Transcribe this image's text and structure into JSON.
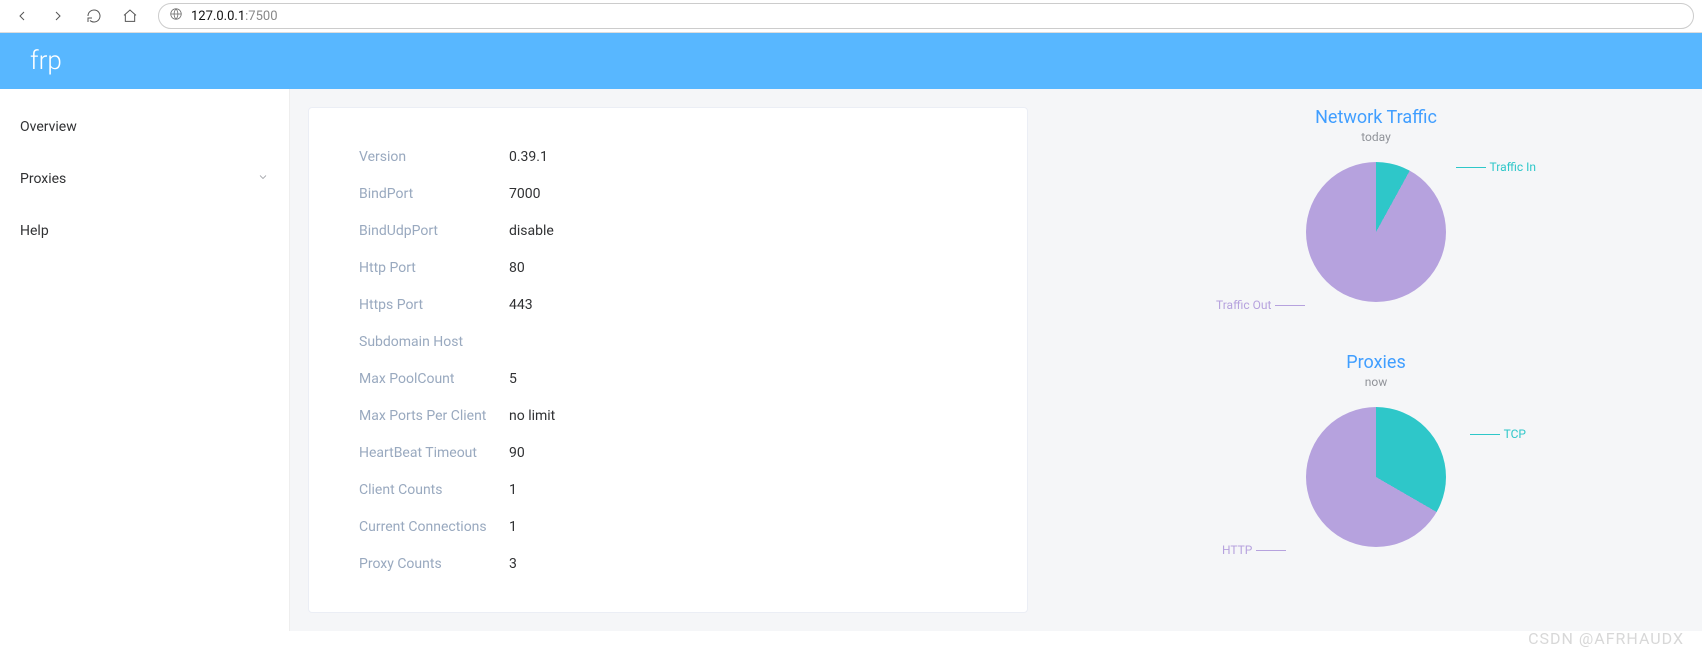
{
  "browser": {
    "url_host": "127.0.0.1",
    "url_port": ":7500"
  },
  "app": {
    "title": "frp"
  },
  "sidebar": {
    "items": [
      {
        "label": "Overview"
      },
      {
        "label": "Proxies"
      },
      {
        "label": "Help"
      }
    ]
  },
  "overview": {
    "rows": [
      {
        "label": "Version",
        "value": "0.39.1"
      },
      {
        "label": "BindPort",
        "value": "7000"
      },
      {
        "label": "BindUdpPort",
        "value": "disable"
      },
      {
        "label": "Http Port",
        "value": "80"
      },
      {
        "label": "Https Port",
        "value": "443"
      },
      {
        "label": "Subdomain Host",
        "value": ""
      },
      {
        "label": "Max PoolCount",
        "value": "5"
      },
      {
        "label": "Max Ports Per Client",
        "value": "no limit"
      },
      {
        "label": "HeartBeat Timeout",
        "value": "90"
      },
      {
        "label": "Client Counts",
        "value": "1"
      },
      {
        "label": "Current Connections",
        "value": "1"
      },
      {
        "label": "Proxy Counts",
        "value": "3"
      }
    ]
  },
  "charts": {
    "traffic": {
      "title": "Network Traffic",
      "subtitle": "today",
      "labels": {
        "in": "Traffic In",
        "out": "Traffic Out"
      },
      "colors": {
        "in": "#2ec7c9",
        "out": "#b6a2de"
      }
    },
    "proxies": {
      "title": "Proxies",
      "subtitle": "now",
      "labels": {
        "tcp": "TCP",
        "http": "HTTP"
      },
      "colors": {
        "tcp": "#2ec7c9",
        "http": "#b6a2de"
      }
    }
  },
  "watermark": "CSDN @AFRHAUDX",
  "chart_data": [
    {
      "type": "pie",
      "title": "Network Traffic",
      "subtitle": "today",
      "series": [
        {
          "name": "Traffic In",
          "value": 8,
          "color": "#2ec7c9"
        },
        {
          "name": "Traffic Out",
          "value": 92,
          "color": "#b6a2de"
        }
      ]
    },
    {
      "type": "pie",
      "title": "Proxies",
      "subtitle": "now",
      "series": [
        {
          "name": "TCP",
          "value": 1,
          "color": "#2ec7c9"
        },
        {
          "name": "HTTP",
          "value": 2,
          "color": "#b6a2de"
        }
      ]
    }
  ]
}
